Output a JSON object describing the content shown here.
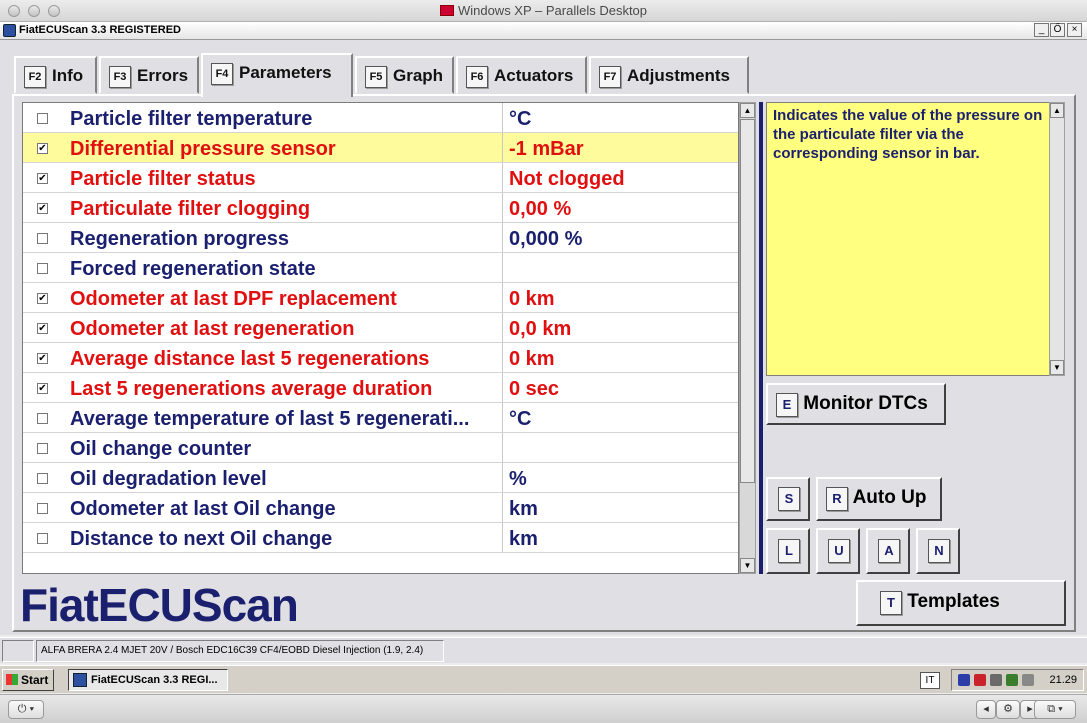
{
  "mac_window": {
    "title": "Windows XP – Parallels Desktop"
  },
  "app_window": {
    "title": "FiatECUScan 3.3 REGISTERED",
    "controls": {
      "minimize": "_",
      "restore": "Ő",
      "close": "×"
    }
  },
  "tabs": [
    {
      "key": "F2",
      "label": "Info"
    },
    {
      "key": "F3",
      "label": "Errors"
    },
    {
      "key": "F4",
      "label": "Parameters"
    },
    {
      "key": "F5",
      "label": "Graph"
    },
    {
      "key": "F6",
      "label": "Actuators"
    },
    {
      "key": "F7",
      "label": "Adjustments"
    }
  ],
  "active_tab": "Parameters",
  "parameters": [
    {
      "name": "Particle filter temperature",
      "value": "°C",
      "checked": false,
      "mark": ""
    },
    {
      "name": "Differential pressure sensor",
      "value": "-1 mBar",
      "checked": true,
      "mark": "✔"
    },
    {
      "name": "Particle filter status",
      "value": "Not clogged",
      "checked": true,
      "mark": "✔"
    },
    {
      "name": "Particulate filter clogging",
      "value": "0,00 %",
      "checked": true,
      "mark": "✔"
    },
    {
      "name": "Regeneration progress",
      "value": "0,000 %",
      "checked": false,
      "mark": ""
    },
    {
      "name": "Forced regeneration state",
      "value": "",
      "checked": false,
      "mark": ""
    },
    {
      "name": "Odometer at last DPF replacement",
      "value": "0 km",
      "checked": true,
      "mark": "✔"
    },
    {
      "name": "Odometer at last regeneration",
      "value": "0,0 km",
      "checked": true,
      "mark": "✔"
    },
    {
      "name": "Average distance last 5 regenerations",
      "value": "0 km",
      "checked": true,
      "mark": "✔"
    },
    {
      "name": "Last 5 regenerations average duration",
      "value": "0 sec",
      "checked": true,
      "mark": "✔"
    },
    {
      "name": "Average temperature of last 5 regenerati...",
      "value": "°C",
      "checked": false,
      "mark": ""
    },
    {
      "name": "Oil change counter",
      "value": "",
      "checked": false,
      "mark": ""
    },
    {
      "name": "Oil degradation level",
      "value": "%",
      "checked": false,
      "mark": ""
    },
    {
      "name": "Odometer at last Oil change",
      "value": "km",
      "checked": false,
      "mark": ""
    },
    {
      "name": "Distance to next Oil change",
      "value": "km",
      "checked": false,
      "mark": ""
    }
  ],
  "colors": {
    "checked_text": "#e01010",
    "unchecked_text": "#1a1f6e",
    "highlight_row": "#fdfb9b",
    "description_bg": "#ffff80"
  },
  "description": "Indicates the value of the pressure on the particulate filter via the corresponding sensor in bar.",
  "buttons": {
    "monitor_dtcs": {
      "key": "E",
      "label": "Monitor DTCs"
    },
    "s": {
      "key": "S"
    },
    "auto_up": {
      "key": "R",
      "label": "Auto Up"
    },
    "l": {
      "key": "L"
    },
    "u": {
      "key": "U"
    },
    "a": {
      "key": "A"
    },
    "n": {
      "key": "N"
    },
    "templates": {
      "key": "T",
      "label": "Templates"
    }
  },
  "logo": "FiatECUScan",
  "status": {
    "vehicle": "ALFA BRERA 2.4 MJET 20V / Bosch EDC16C39 CF4/EOBD Diesel Injection (1.9, 2.4)"
  },
  "taskbar": {
    "start_label": "Start",
    "task_label": "FiatECUScan 3.3 REGI...",
    "language": "IT",
    "clock": "21.29"
  },
  "mac_bottom": {
    "power": "⏻ ▾",
    "back": "◂",
    "gear": "⚙",
    "forward": "▸",
    "window": "⧉ ▾"
  }
}
